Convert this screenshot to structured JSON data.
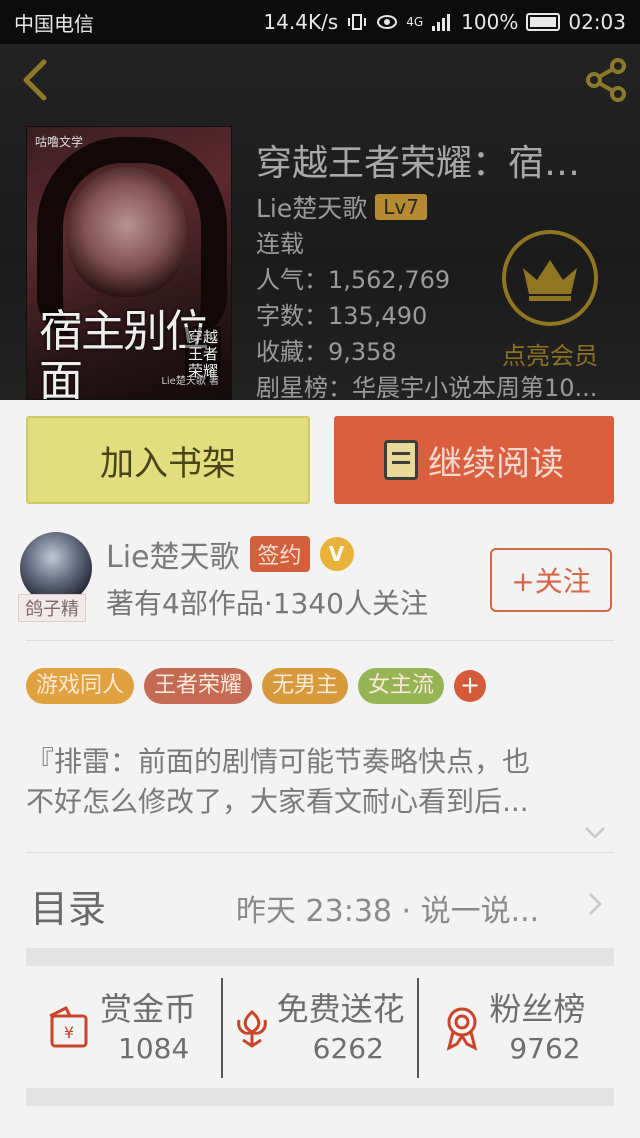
{
  "status_bar": {
    "carrier": "中国电信",
    "speed": "14.4K/s",
    "network": "4G",
    "battery": "100%",
    "time": "02:03"
  },
  "book": {
    "cover_title": "宿主别位面",
    "cover_subtitle": "穿越王者荣耀",
    "cover_brand": "咕噜文学",
    "cover_author": "Lie楚天歌 著",
    "title": "穿越王者荣耀：宿主别...",
    "author": "Lie楚天歌",
    "level": "Lv7",
    "status": "连载",
    "popularity": "人气：1,562,769",
    "words": "字数：135,490",
    "favorites": "收藏：9,358",
    "rank": "剧星榜：华晨宇小说本周第10..."
  },
  "member": {
    "label": "点亮会员"
  },
  "buttons": {
    "add_shelf": "加入书架",
    "continue_read": "继续阅读"
  },
  "author_card": {
    "avatar_tag": "鸽子精",
    "name": "Lie楚天歌",
    "signed": "签约",
    "verified": "V",
    "description": "著有4部作品·1340人关注",
    "follow": "+关注"
  },
  "tags": [
    "游戏同人",
    "王者荣耀",
    "无男主",
    "女主流"
  ],
  "tags_more": "+",
  "synopsis": {
    "line1": "『排雷：前面的剧情可能节奏略快点，也",
    "line2": "不好怎么修改了，大家看文耐心看到后..."
  },
  "toc": {
    "label": "目录",
    "meta": "昨天 23:38 · 说一说..."
  },
  "stats": [
    {
      "name": "赏金币",
      "value": "1084",
      "icon": "coin-envelope-icon"
    },
    {
      "name": "免费送花",
      "value": "6262",
      "icon": "flower-icon"
    },
    {
      "name": "粉丝榜",
      "value": "9762",
      "icon": "medal-icon"
    }
  ],
  "colors": {
    "accent_orange": "#d95f3f",
    "shelf_yellow": "#e2dd7f",
    "gold": "#8f7622"
  }
}
